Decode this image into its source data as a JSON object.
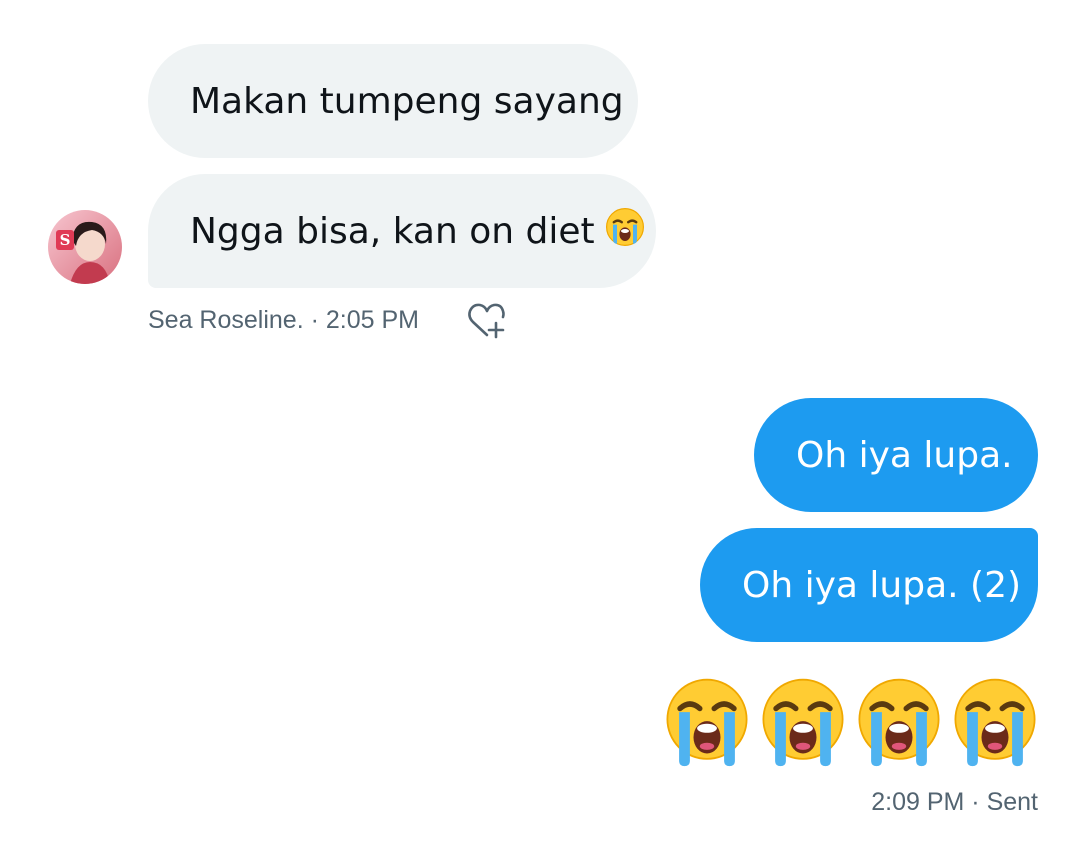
{
  "conversation": {
    "incoming": [
      {
        "text": "Makan tumpeng sayang"
      },
      {
        "text": "Ngga bisa, kan on diet"
      }
    ],
    "incoming_meta": {
      "sender": "Sea Roseline.",
      "separator": " · ",
      "time": "2:05 PM"
    },
    "outgoing": [
      {
        "text": "Oh iya lupa."
      },
      {
        "text": "Oh iya lupa. (2)"
      }
    ],
    "outgoing_emoji_count": 4,
    "outgoing_meta": {
      "time": "2:09 PM",
      "separator": " · ",
      "status": "Sent"
    }
  },
  "icons": {
    "inline_emoji": "loudly-crying-face-emoji",
    "reaction": "heart-plus-icon",
    "avatar_letter": "S"
  },
  "colors": {
    "incoming_bubble": "#eff3f4",
    "outgoing_bubble": "#1d9bf0",
    "meta_text": "#536471",
    "text": "#0f1419"
  }
}
